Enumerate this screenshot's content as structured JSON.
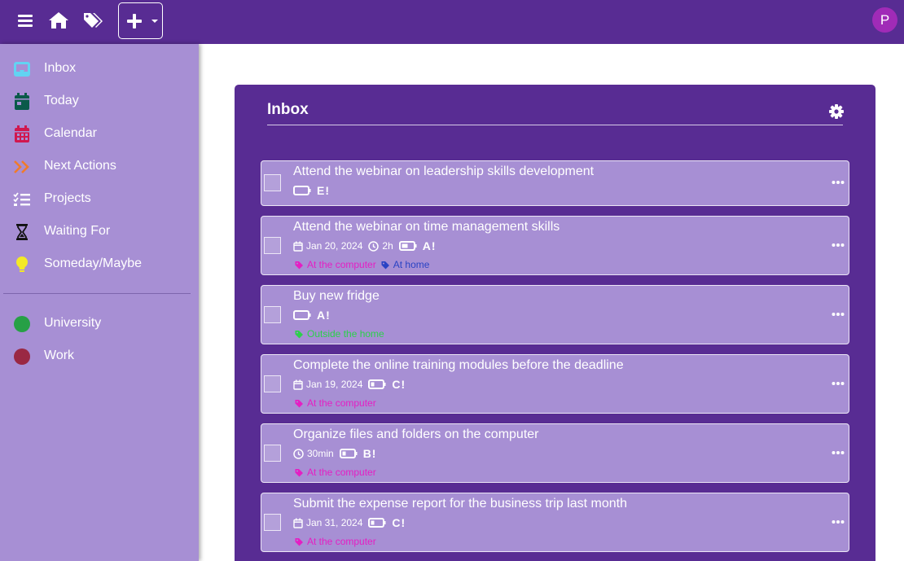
{
  "topbar": {
    "icons": [
      "menu-icon",
      "home-icon",
      "tags-icon",
      "plus-icon"
    ],
    "avatar_initial": "P"
  },
  "sidebar": {
    "items": [
      {
        "label": "Inbox",
        "icon": "inbox-icon",
        "color": "#62d3f2"
      },
      {
        "label": "Today",
        "icon": "calendar-today-icon",
        "color": "#0b5a4a"
      },
      {
        "label": "Calendar",
        "icon": "calendar-grid-icon",
        "color": "#d1184f"
      },
      {
        "label": "Next Actions",
        "icon": "double-chevron-right-icon",
        "color": "#f07b2b"
      },
      {
        "label": "Projects",
        "icon": "checklist-icon",
        "color": "#ffffff"
      },
      {
        "label": "Waiting For",
        "icon": "hourglass-icon",
        "color": "#111111"
      },
      {
        "label": "Someday/Maybe",
        "icon": "lightbulb-icon",
        "color": "#f3e926"
      }
    ],
    "projects": [
      {
        "label": "University",
        "color": "#27a046"
      },
      {
        "label": "Work",
        "color": "#9a2843"
      }
    ]
  },
  "main": {
    "title": "Inbox",
    "tasks": [
      {
        "title": "Attend the webinar on leadership skills development",
        "date": "",
        "duration": "",
        "energy": "full",
        "priority": "E!",
        "tags": []
      },
      {
        "title": "Attend the webinar on time management skills",
        "date": "Jan 20, 2024",
        "duration": "2h",
        "energy": "medium",
        "priority": "A!",
        "tags": [
          {
            "label": "At the computer",
            "color": "#e51ec3"
          },
          {
            "label": "At home",
            "color": "#2a43c4"
          }
        ]
      },
      {
        "title": "Buy new fridge",
        "date": "",
        "duration": "",
        "energy": "full",
        "priority": "A!",
        "tags": [
          {
            "label": "Outside the home",
            "color": "#2bd04a"
          }
        ]
      },
      {
        "title": "Complete the online training modules before the deadline",
        "date": "Jan 19, 2024",
        "duration": "",
        "energy": "low",
        "priority": "C!",
        "tags": [
          {
            "label": "At the computer",
            "color": "#e51ec3"
          }
        ]
      },
      {
        "title": "Organize files and folders on the computer",
        "date": "",
        "duration": "30min",
        "energy": "low",
        "priority": "B!",
        "tags": [
          {
            "label": "At the computer",
            "color": "#e51ec3"
          }
        ]
      },
      {
        "title": "Submit the expense report for the business trip last month",
        "date": "Jan 31, 2024",
        "duration": "",
        "energy": "low",
        "priority": "C!",
        "tags": [
          {
            "label": "At the computer",
            "color": "#e51ec3"
          }
        ]
      }
    ]
  }
}
